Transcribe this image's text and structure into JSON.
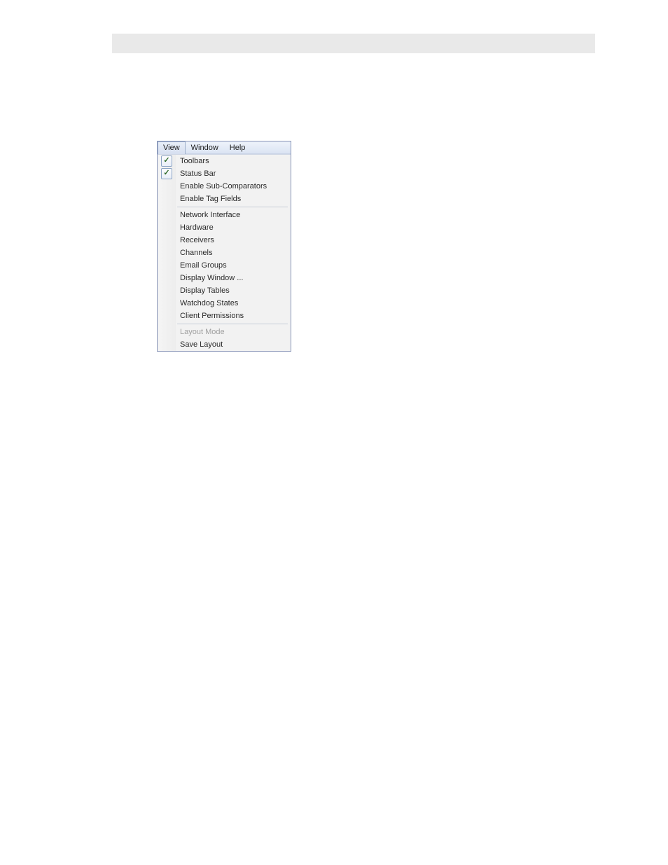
{
  "menubar": {
    "items": [
      {
        "label": "View",
        "active": true
      },
      {
        "label": "Window",
        "active": false
      },
      {
        "label": "Help",
        "active": false
      }
    ]
  },
  "dropdown": {
    "groups": [
      [
        {
          "label": "Toolbars",
          "checked": true,
          "disabled": false
        },
        {
          "label": "Status Bar",
          "checked": true,
          "disabled": false
        },
        {
          "label": "Enable Sub-Comparators",
          "checked": false,
          "disabled": false
        },
        {
          "label": "Enable Tag Fields",
          "checked": false,
          "disabled": false
        }
      ],
      [
        {
          "label": "Network Interface",
          "checked": false,
          "disabled": false
        },
        {
          "label": "Hardware",
          "checked": false,
          "disabled": false
        },
        {
          "label": "Receivers",
          "checked": false,
          "disabled": false
        },
        {
          "label": "Channels",
          "checked": false,
          "disabled": false
        },
        {
          "label": "Email Groups",
          "checked": false,
          "disabled": false
        },
        {
          "label": "Display Window ...",
          "checked": false,
          "disabled": false
        },
        {
          "label": "Display Tables",
          "checked": false,
          "disabled": false
        },
        {
          "label": "Watchdog States",
          "checked": false,
          "disabled": false
        },
        {
          "label": "Client Permissions",
          "checked": false,
          "disabled": false
        }
      ],
      [
        {
          "label": "Layout Mode",
          "checked": false,
          "disabled": true
        },
        {
          "label": "Save Layout",
          "checked": false,
          "disabled": false
        }
      ]
    ]
  }
}
